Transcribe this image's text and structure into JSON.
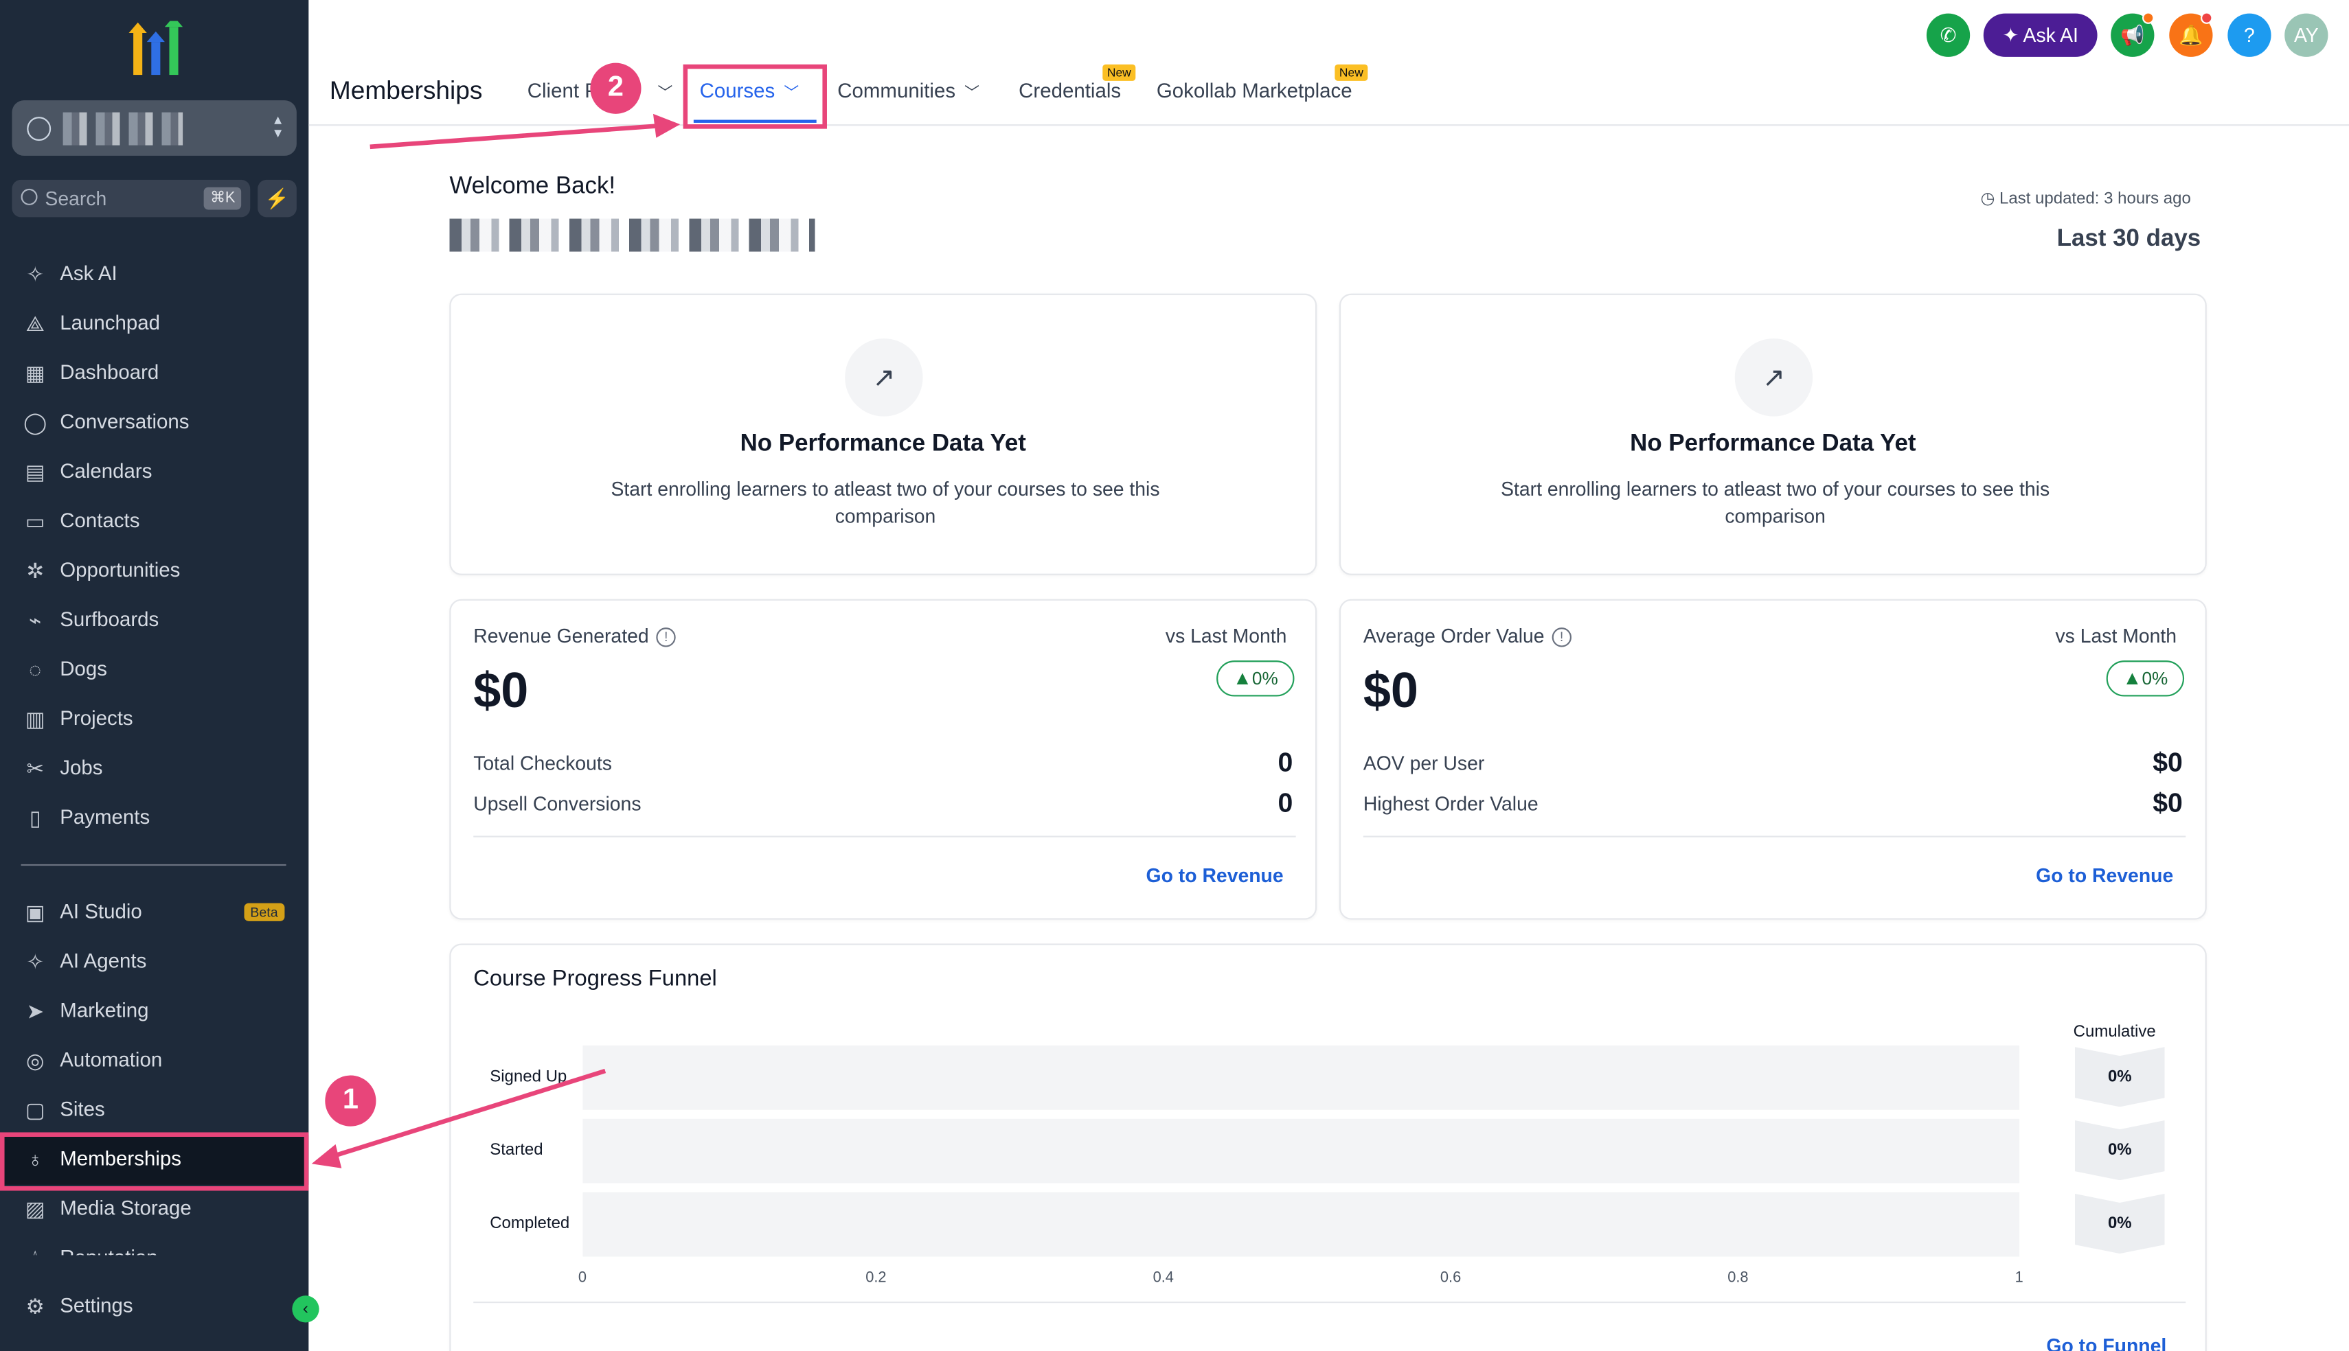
{
  "sidebar": {
    "search_placeholder": "Search",
    "search_shortcut": "⌘K",
    "nav": [
      {
        "label": "Ask AI",
        "icon": "sparkle-icon"
      },
      {
        "label": "Launchpad",
        "icon": "rocket-icon"
      },
      {
        "label": "Dashboard",
        "icon": "grid-icon"
      },
      {
        "label": "Conversations",
        "icon": "chat-icon"
      },
      {
        "label": "Calendars",
        "icon": "calendar-icon"
      },
      {
        "label": "Contacts",
        "icon": "contacts-icon"
      },
      {
        "label": "Opportunities",
        "icon": "opportunities-icon"
      },
      {
        "label": "Surfboards",
        "icon": "surfboard-icon"
      },
      {
        "label": "Dogs",
        "icon": "dog-icon"
      },
      {
        "label": "Projects",
        "icon": "projects-icon"
      },
      {
        "label": "Jobs",
        "icon": "jobs-icon"
      },
      {
        "label": "Payments",
        "icon": "payments-icon"
      }
    ],
    "nav2": [
      {
        "label": "AI Studio",
        "icon": "ai-studio-icon",
        "badge": "Beta"
      },
      {
        "label": "AI Agents",
        "icon": "ai-agents-icon"
      },
      {
        "label": "Marketing",
        "icon": "send-icon"
      },
      {
        "label": "Automation",
        "icon": "automation-icon"
      },
      {
        "label": "Sites",
        "icon": "sites-icon"
      },
      {
        "label": "Memberships",
        "icon": "award-icon",
        "active": true
      },
      {
        "label": "Media Storage",
        "icon": "image-icon"
      },
      {
        "label": "Reputation",
        "icon": "star-icon"
      }
    ],
    "settings_label": "Settings"
  },
  "header": {
    "title": "Memberships",
    "tabs": [
      {
        "label": "Client P",
        "dropdown": true
      },
      {
        "label": "Courses",
        "dropdown": true,
        "active": true
      },
      {
        "label": "Communities",
        "dropdown": true
      },
      {
        "label": "Credentials",
        "badge": "New"
      },
      {
        "label": "Gokollab Marketplace",
        "badge": "New"
      }
    ],
    "ask_ai_label": "Ask AI",
    "avatar_initials": "AY",
    "help_label": "?"
  },
  "annotations": {
    "step1": "1",
    "step2": "2"
  },
  "dashboard": {
    "welcome": "Welcome Back!",
    "last_updated": "Last updated: 3 hours ago",
    "range": "Last 30 days",
    "perf_cards": [
      {
        "title": "No Performance Data Yet",
        "desc": "Start enrolling learners to atleast two of your courses to see this comparison"
      },
      {
        "title": "No Performance Data Yet",
        "desc": "Start enrolling learners to atleast two of your courses to see this comparison"
      }
    ],
    "revenue": {
      "label": "Revenue Generated",
      "vs": "vs Last Month",
      "value": "$0",
      "change": "0%",
      "rows": [
        {
          "label": "Total Checkouts",
          "value": "0"
        },
        {
          "label": "Upsell Conversions",
          "value": "0"
        }
      ],
      "link": "Go to Revenue"
    },
    "aov": {
      "label": "Average Order Value",
      "vs": "vs Last Month",
      "value": "$0",
      "change": "0%",
      "rows": [
        {
          "label": "AOV per User",
          "value": "$0"
        },
        {
          "label": "Highest Order Value",
          "value": "$0"
        }
      ],
      "link": "Go to Revenue"
    },
    "funnel": {
      "title": "Course Progress Funnel",
      "cumulative_label": "Cumulative",
      "link": "Go to Funnel"
    }
  },
  "chart_data": {
    "type": "bar",
    "orientation": "horizontal",
    "title": "Course Progress Funnel",
    "categories": [
      "Signed Up",
      "Started",
      "Completed"
    ],
    "values": [
      0,
      0,
      0
    ],
    "cumulative": [
      "0%",
      "0%",
      "0%"
    ],
    "xlim": [
      0,
      1
    ],
    "xticks": [
      "0",
      "0.2",
      "0.4",
      "0.6",
      "0.8",
      "1"
    ]
  }
}
